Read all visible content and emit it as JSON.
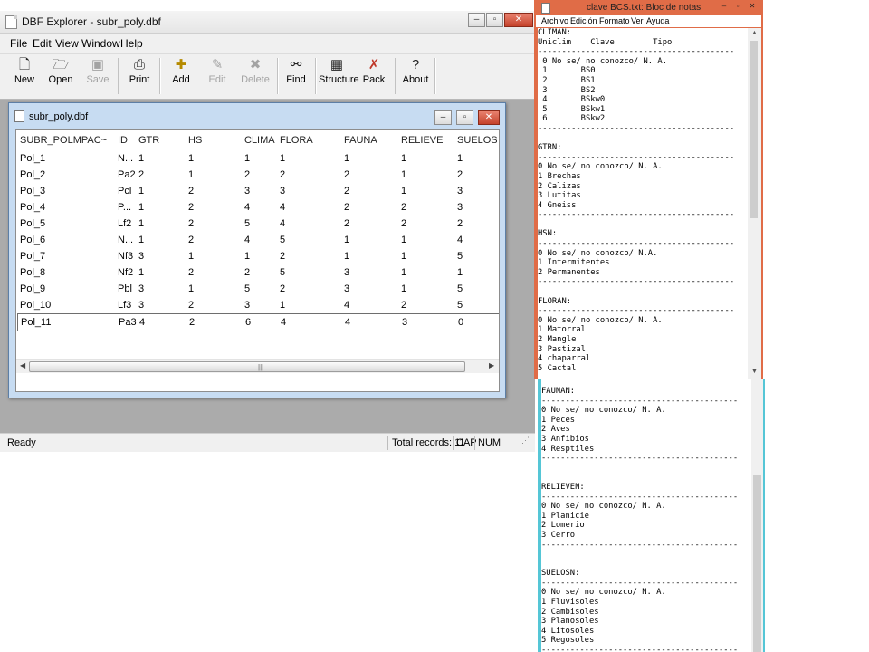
{
  "dbf_window": {
    "title": "DBF Explorer - subr_poly.dbf",
    "menu": [
      "File",
      "Edit",
      "View",
      "Window",
      "Help"
    ],
    "toolbar": [
      {
        "label": "New",
        "icon": "new-file-icon",
        "enabled": true
      },
      {
        "label": "Open",
        "icon": "open-folder-icon",
        "enabled": true
      },
      {
        "label": "Save",
        "icon": "save-disk-icon",
        "enabled": false
      },
      {
        "label": "Print",
        "icon": "printer-icon",
        "enabled": true
      },
      {
        "label": "Add",
        "icon": "add-record-icon",
        "enabled": true
      },
      {
        "label": "Edit",
        "icon": "edit-record-icon",
        "enabled": false
      },
      {
        "label": "Delete",
        "icon": "delete-record-icon",
        "enabled": false
      },
      {
        "label": "Find",
        "icon": "binoculars-icon",
        "enabled": true
      },
      {
        "label": "Structure",
        "icon": "structure-icon",
        "enabled": true
      },
      {
        "label": "Pack",
        "icon": "pack-icon",
        "enabled": true
      },
      {
        "label": "About",
        "icon": "question-icon",
        "enabled": true
      }
    ],
    "child_window": {
      "title": "subr_poly.dbf",
      "columns": [
        "SUBR_POLMPAC~",
        "ID",
        "GTR",
        "HS",
        "CLIMA",
        "FLORA",
        "FAUNA",
        "RELIEVE",
        "SUELOS"
      ],
      "rows": [
        [
          "Pol_1",
          "N...",
          "1",
          "1",
          "1",
          "1",
          "1",
          "1",
          "1"
        ],
        [
          "Pol_2",
          "Pa2",
          "2",
          "1",
          "2",
          "2",
          "2",
          "1",
          "2"
        ],
        [
          "Pol_3",
          "Pcl",
          "1",
          "2",
          "3",
          "3",
          "2",
          "1",
          "3"
        ],
        [
          "Pol_4",
          "P...",
          "1",
          "2",
          "4",
          "4",
          "2",
          "2",
          "3"
        ],
        [
          "Pol_5",
          "Lf2",
          "1",
          "2",
          "5",
          "4",
          "2",
          "2",
          "2"
        ],
        [
          "Pol_6",
          "N...",
          "1",
          "2",
          "4",
          "5",
          "1",
          "1",
          "4"
        ],
        [
          "Pol_7",
          "Nf3",
          "3",
          "1",
          "1",
          "2",
          "1",
          "1",
          "5"
        ],
        [
          "Pol_8",
          "Nf2",
          "1",
          "2",
          "2",
          "5",
          "3",
          "1",
          "1"
        ],
        [
          "Pol_9",
          "Pbl",
          "3",
          "1",
          "5",
          "2",
          "3",
          "1",
          "5"
        ],
        [
          "Pol_10",
          "Lf3",
          "3",
          "2",
          "3",
          "1",
          "4",
          "2",
          "5"
        ],
        [
          "Pol_11",
          "Pa3",
          "4",
          "2",
          "6",
          "4",
          "4",
          "3",
          "0"
        ]
      ],
      "selected_row": 10
    },
    "status": {
      "left": "Ready",
      "records": "Total records: 11",
      "cap": "CAP",
      "num": "NUM"
    }
  },
  "notepad": {
    "title": "clave BCS.txt: Bloc de notas",
    "menu": [
      "Archivo",
      "Edición",
      "Formato",
      "Ver",
      "Ayuda"
    ],
    "text_top": "CLIMAN:\nUniclim    Clave        Tipo\n-----------------------------------------\n 0 No se/ no conozco/ N. A.\n 1       BS0\n 2       BS1\n 3       BS2\n 4       BSkw0\n 5       BSkw1\n 6       BSkw2\n-----------------------------------------\n\nGTRN:\n-----------------------------------------\n0 No se/ no conozco/ N. A.\n1 Brechas\n2 Calizas\n3 Lutitas\n4 Gneiss\n-----------------------------------------\n\nHSN:\n-----------------------------------------\n0 No se/ no conozco/ N.A.\n1 Intermitentes\n2 Permanentes\n-----------------------------------------\n\nFLORAN:\n-----------------------------------------\n0 No se/ no conozco/ N. A.\n1 Matorral\n2 Mangle\n3 Pastizal\n4 chaparral\n5 Cactal",
    "text_bottom": "FAUNAN:\n-----------------------------------------\n0 No se/ no conozco/ N. A.\n1 Peces\n2 Aves\n3 Anfibios\n4 Resptiles\n-----------------------------------------\n\n\nRELIEVEN:\n-----------------------------------------\n0 No se/ no conozco/ N. A.\n1 Planicie\n2 Lomerio\n3 Cerro\n-----------------------------------------\n\n\nSUELOSN:\n-----------------------------------------\n0 No se/ no conozco/ N. A.\n1 Fluvisoles\n2 Cambisoles\n3 Planosoles\n4 Litosoles\n5 Regosoles\n-----------------------------------------"
  }
}
